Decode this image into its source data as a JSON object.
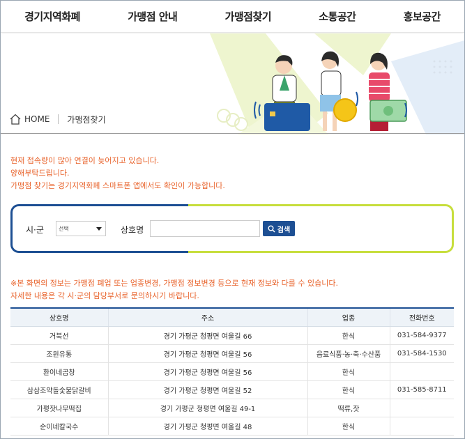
{
  "nav": {
    "items": [
      "경기지역화폐",
      "가맹점 안내",
      "가맹점찾기",
      "소통공간",
      "홍보공간"
    ]
  },
  "breadcrumb": {
    "home": "HOME",
    "current": "가맹점찾기"
  },
  "notice": {
    "line1": "현재 접속량이 많아 연결이 늦어지고 있습니다.",
    "line2": "양해부탁드립니다.",
    "line3": "가맹점 찾기는 경기지역화폐 스마트폰 앱에서도 확인이 가능합니다."
  },
  "search": {
    "city_label": "시·군",
    "city_selected": "선택",
    "name_label": "상호명",
    "name_value": "",
    "button_label": "검색"
  },
  "info": {
    "line1": "※본 화면의 정보는 가맹점 폐업 또는 업종변경, 가맹점 정보변경 등으로 현재 정보와 다를 수 있습니다.",
    "line2": "자세한 내용은 각 시·군의 담당부서로 문의하시기 바랍니다."
  },
  "table": {
    "headers": [
      "상호명",
      "주소",
      "업종",
      "전화번호"
    ],
    "rows": [
      [
        "거북선",
        "경기 가평군 청평면 여울길 66",
        "한식",
        "031-584-9377"
      ],
      [
        "조원유통",
        "경기 가평군 청평면 여울길 56",
        "음료식품·농·축·수산품",
        "031-584-1530"
      ],
      [
        "환이네곱창",
        "경기 가평군 청평면 여울길 56",
        "한식",
        ""
      ],
      [
        "삼삼조약돌숯불닭갈비",
        "경기 가평군 청평면 여울길 52",
        "한식",
        "031-585-8711"
      ],
      [
        "가평잣나무떡집",
        "경기 가평군 청평면 여울길 49-1",
        "떡류,잣",
        ""
      ],
      [
        "순이네칼국수",
        "경기 가평군 청평면 여울길 48",
        "한식",
        ""
      ]
    ]
  },
  "colors": {
    "accent_blue": "#1d4f93",
    "accent_lime": "#c7de3d",
    "notice_orange": "#e8622a"
  },
  "icons": [
    "home-icon",
    "search-icon",
    "caret-down-icon"
  ]
}
